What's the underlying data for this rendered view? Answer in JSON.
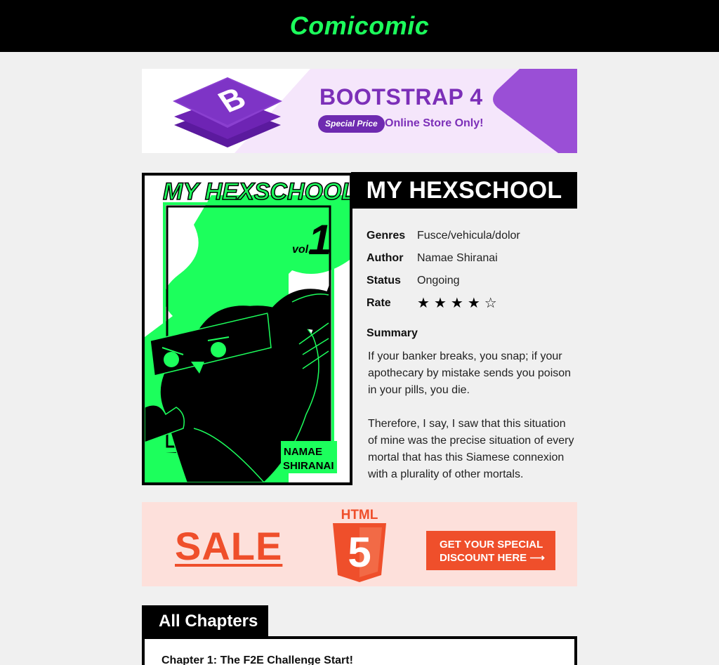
{
  "header": {
    "brand": "Comicomic"
  },
  "ad_bootstrap": {
    "title": "BOOTSTRAP 4",
    "pill": "Special Price",
    "subtitle": "Online Store Only!",
    "logo_letter": "B",
    "colors": {
      "purple": "#7c2fb8",
      "bg": "#f5e6fb"
    }
  },
  "comic": {
    "cover_title": "MY HEXSCHOOL",
    "cover_vol_label": "vol.",
    "cover_vol_num": "1",
    "cover_author_line1": "NAMAE",
    "cover_author_line2": "SHIRANAI",
    "title": "MY HEXSCHOOL",
    "info": [
      {
        "label": "Genres",
        "value": "Fusce/vehicula/dolor"
      },
      {
        "label": "Author",
        "value": "Namae Shiranai"
      },
      {
        "label": "Status",
        "value": "Ongoing"
      }
    ],
    "rate_label": "Rate",
    "rating": {
      "value": 4,
      "max": 5
    },
    "summary_label": "Summary",
    "summary": [
      "If your banker breaks, you snap; if your apothecary by mistake sends you poison in your pills, you die.",
      "Therefore, I say, I saw that this situation of mine was the precise situation of every mortal that has this Siamese connexion with a plurality of other mortals."
    ],
    "colors": {
      "accent": "#1cff5c"
    }
  },
  "ad_html5": {
    "sale": "SALE",
    "badge_text": "HTML",
    "badge_num": "5",
    "cta_line1": "GET YOUR SPECIAL",
    "cta_line2": "DISCOUNT HERE ⟶",
    "colors": {
      "orange": "#ef4f2b",
      "bg": "#fde0db"
    }
  },
  "chapters": {
    "tab_label": "All Chapters",
    "items": [
      "Chapter 1: The F2E Challenge Start!"
    ]
  }
}
